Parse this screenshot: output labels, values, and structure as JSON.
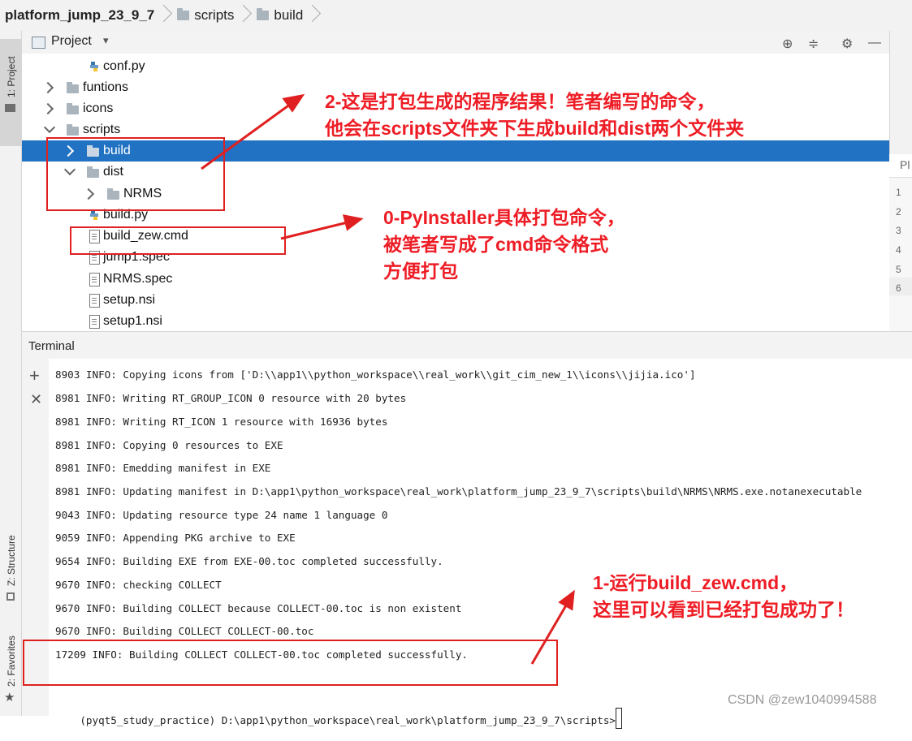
{
  "breadcrumb": [
    "platform_jump_23_9_7",
    "scripts",
    "build"
  ],
  "left_tabs": {
    "project": "1: Project",
    "structure": "Z: Structure",
    "favorites": "2: Favorites"
  },
  "project_panel": {
    "title": "Project",
    "dropdown": "▾",
    "icons": [
      "target-icon",
      "collapse-icon",
      "gear-icon",
      "minimize-icon"
    ]
  },
  "tree": [
    {
      "label": "conf.py",
      "kind": "python"
    },
    {
      "label": "funtions",
      "kind": "folder",
      "state": "collapsed"
    },
    {
      "label": "icons",
      "kind": "folder",
      "state": "collapsed"
    },
    {
      "label": "scripts",
      "kind": "folder",
      "state": "expanded"
    },
    {
      "label": "build",
      "kind": "folder",
      "state": "collapsed",
      "selected": true
    },
    {
      "label": "dist",
      "kind": "folder",
      "state": "expanded"
    },
    {
      "label": "NRMS",
      "kind": "folder",
      "state": "collapsed"
    },
    {
      "label": "build.py",
      "kind": "python"
    },
    {
      "label": "build_zew.cmd",
      "kind": "file"
    },
    {
      "label": "jump1.spec",
      "kind": "file"
    },
    {
      "label": "NRMS.spec",
      "kind": "file"
    },
    {
      "label": "setup.nsi",
      "kind": "unknown"
    },
    {
      "label": "setup1.nsi",
      "kind": "unknown"
    }
  ],
  "editor": {
    "tab_label": "Pl",
    "line_numbers": [
      "1",
      "2",
      "3",
      "4",
      "5",
      "6"
    ]
  },
  "terminal": {
    "title": "Terminal",
    "lines": [
      "8903 INFO: Copying icons from ['D:\\\\app1\\\\python_workspace\\\\real_work\\\\git_cim_new_1\\\\icons\\\\jijia.ico']",
      "8981 INFO: Writing RT_GROUP_ICON 0 resource with 20 bytes",
      "8981 INFO: Writing RT_ICON 1 resource with 16936 bytes",
      "8981 INFO: Copying 0 resources to EXE",
      "8981 INFO: Emedding manifest in EXE",
      "8981 INFO: Updating manifest in D:\\app1\\python_workspace\\real_work\\platform_jump_23_9_7\\scripts\\build\\NRMS\\NRMS.exe.notanexecutable",
      "9043 INFO: Updating resource type 24 name 1 language 0",
      "9059 INFO: Appending PKG archive to EXE",
      "9654 INFO: Building EXE from EXE-00.toc completed successfully.",
      "9670 INFO: checking COLLECT",
      "9670 INFO: Building COLLECT because COLLECT-00.toc is non existent",
      "9670 INFO: Building COLLECT COLLECT-00.toc",
      "17209 INFO: Building COLLECT COLLECT-00.toc completed successfully.",
      "",
      "(pyqt5_study_practice) D:\\app1\\python_workspace\\real_work\\platform_jump_23_9_7\\scripts>"
    ]
  },
  "annotations": {
    "a2": [
      "2-这是打包生成的程序结果！笔者编写的命令，",
      "他会在scripts文件夹下生成build和dist两个文件夹"
    ],
    "a0": [
      "0-PyInstaller具体打包命令，",
      "被笔者写成了cmd命令格式",
      "方便打包"
    ],
    "a1": [
      "1-运行build_zew.cmd，",
      "这里可以看到已经打包成功了！"
    ]
  },
  "watermark": "CSDN @zew1040994588",
  "colors": {
    "selection": "#2172c2",
    "annotation": "#ee1c25"
  }
}
